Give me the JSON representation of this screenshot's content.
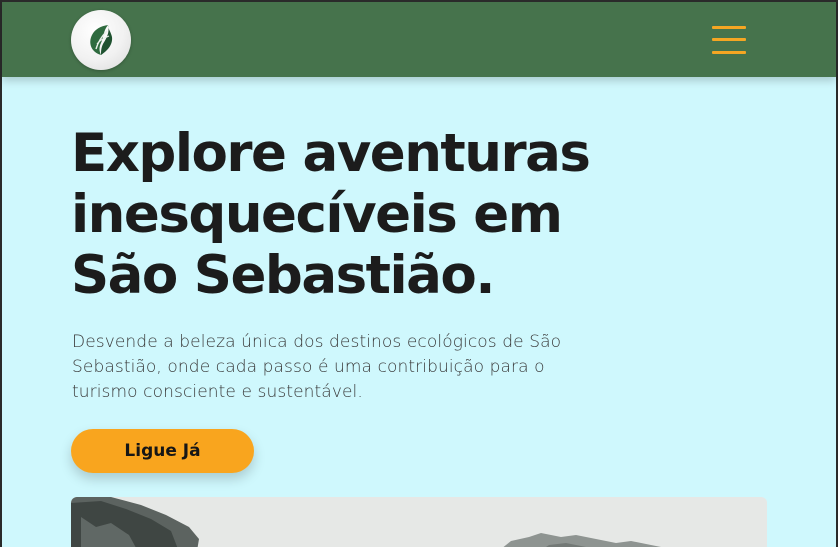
{
  "header": {
    "logo_icon": "leaf-logo-icon",
    "menu_icon": "hamburger-menu-icon"
  },
  "hero": {
    "title": "Explore aventuras inesquecíveis em São Sebastião.",
    "description": "Desvende a beleza única dos destinos ecológicos de São Sebastião, onde cada passo é uma contribuição para o turismo consciente e sustentável.",
    "cta_label": "Ligue Já",
    "image_subject": "mountain-landscape"
  },
  "colors": {
    "navbar": "#46734c",
    "background": "#cff8fd",
    "accent": "#f9a51e",
    "title_text": "#1c1c1c"
  }
}
